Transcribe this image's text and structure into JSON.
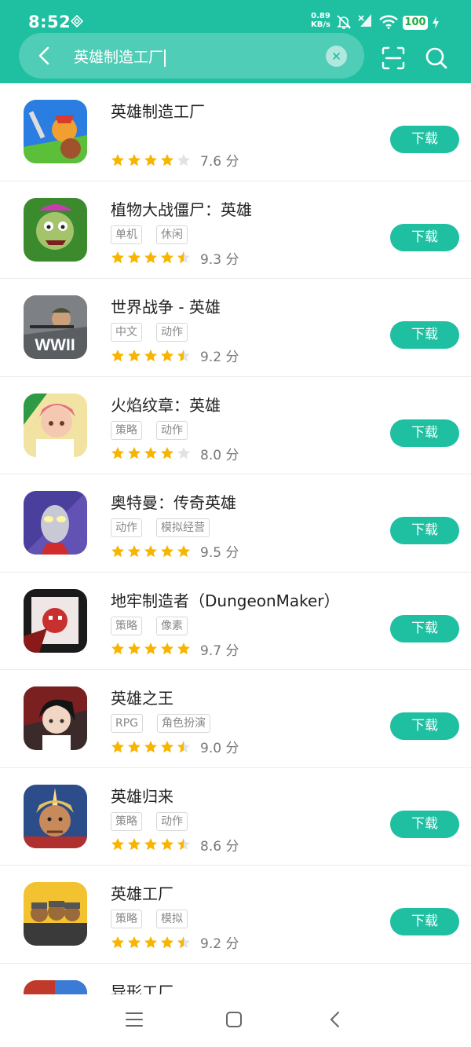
{
  "status_bar": {
    "time": "8:52",
    "net_speed_value": "0.89",
    "net_speed_unit": "KB/s",
    "battery": "100",
    "icons": [
      "diamond-icon",
      "bell-off-icon",
      "signal-off-icon",
      "wifi-icon",
      "battery-icon",
      "charging-bolt-icon"
    ]
  },
  "search": {
    "query": "英雄制造工厂",
    "icons": [
      "back-arrow-icon",
      "clear-icon",
      "scan-icon",
      "search-icon"
    ]
  },
  "colors": {
    "accent": "#1fbfa2",
    "star": "#f7b500",
    "star_empty": "#e2e2e2"
  },
  "apps": [
    {
      "name": "英雄制造工厂",
      "tags": [],
      "rating": 4,
      "score": "7.6 分",
      "button": "下载",
      "icon": "icon-hero-factory"
    },
    {
      "name": "植物大战僵尸：英雄",
      "tags": [
        "单机",
        "休闲"
      ],
      "rating": 4.5,
      "score": "9.3 分",
      "button": "下载",
      "icon": "icon-pvz-heroes"
    },
    {
      "name": "世界战争 - 英雄",
      "tags": [
        "中文",
        "动作"
      ],
      "rating": 4.5,
      "score": "9.2 分",
      "button": "下载",
      "icon": "icon-wwii",
      "icon_text": "WWII"
    },
    {
      "name": "火焰纹章：英雄",
      "tags": [
        "策略",
        "动作"
      ],
      "rating": 4,
      "score": "8.0 分",
      "button": "下载",
      "icon": "icon-fire-emblem"
    },
    {
      "name": "奥特曼：传奇英雄",
      "tags": [
        "动作",
        "模拟经营"
      ],
      "rating": 5,
      "score": "9.5 分",
      "button": "下载",
      "icon": "icon-ultraman"
    },
    {
      "name": "地牢制造者（DungeonMaker）",
      "tags": [
        "策略",
        "像素"
      ],
      "rating": 5,
      "score": "9.7 分",
      "button": "下载",
      "icon": "icon-dungeon-maker"
    },
    {
      "name": "英雄之王",
      "tags": [
        "RPG",
        "角色扮演"
      ],
      "rating": 4.5,
      "score": "9.0 分",
      "button": "下载",
      "icon": "icon-hero-king"
    },
    {
      "name": "英雄归来",
      "tags": [
        "策略",
        "动作"
      ],
      "rating": 4.5,
      "score": "8.6 分",
      "button": "下载",
      "icon": "icon-hero-return"
    },
    {
      "name": "英雄工厂",
      "tags": [
        "策略",
        "模拟"
      ],
      "rating": 4.5,
      "score": "9.2 分",
      "button": "下载",
      "icon": "icon-hero-works"
    },
    {
      "name": "异形工厂",
      "tags": [],
      "rating": 0,
      "score": "",
      "button": "",
      "icon": "icon-alien-factory"
    }
  ],
  "nav_bar": {
    "icons": [
      "menu-icon",
      "home-icon",
      "back-icon"
    ]
  }
}
